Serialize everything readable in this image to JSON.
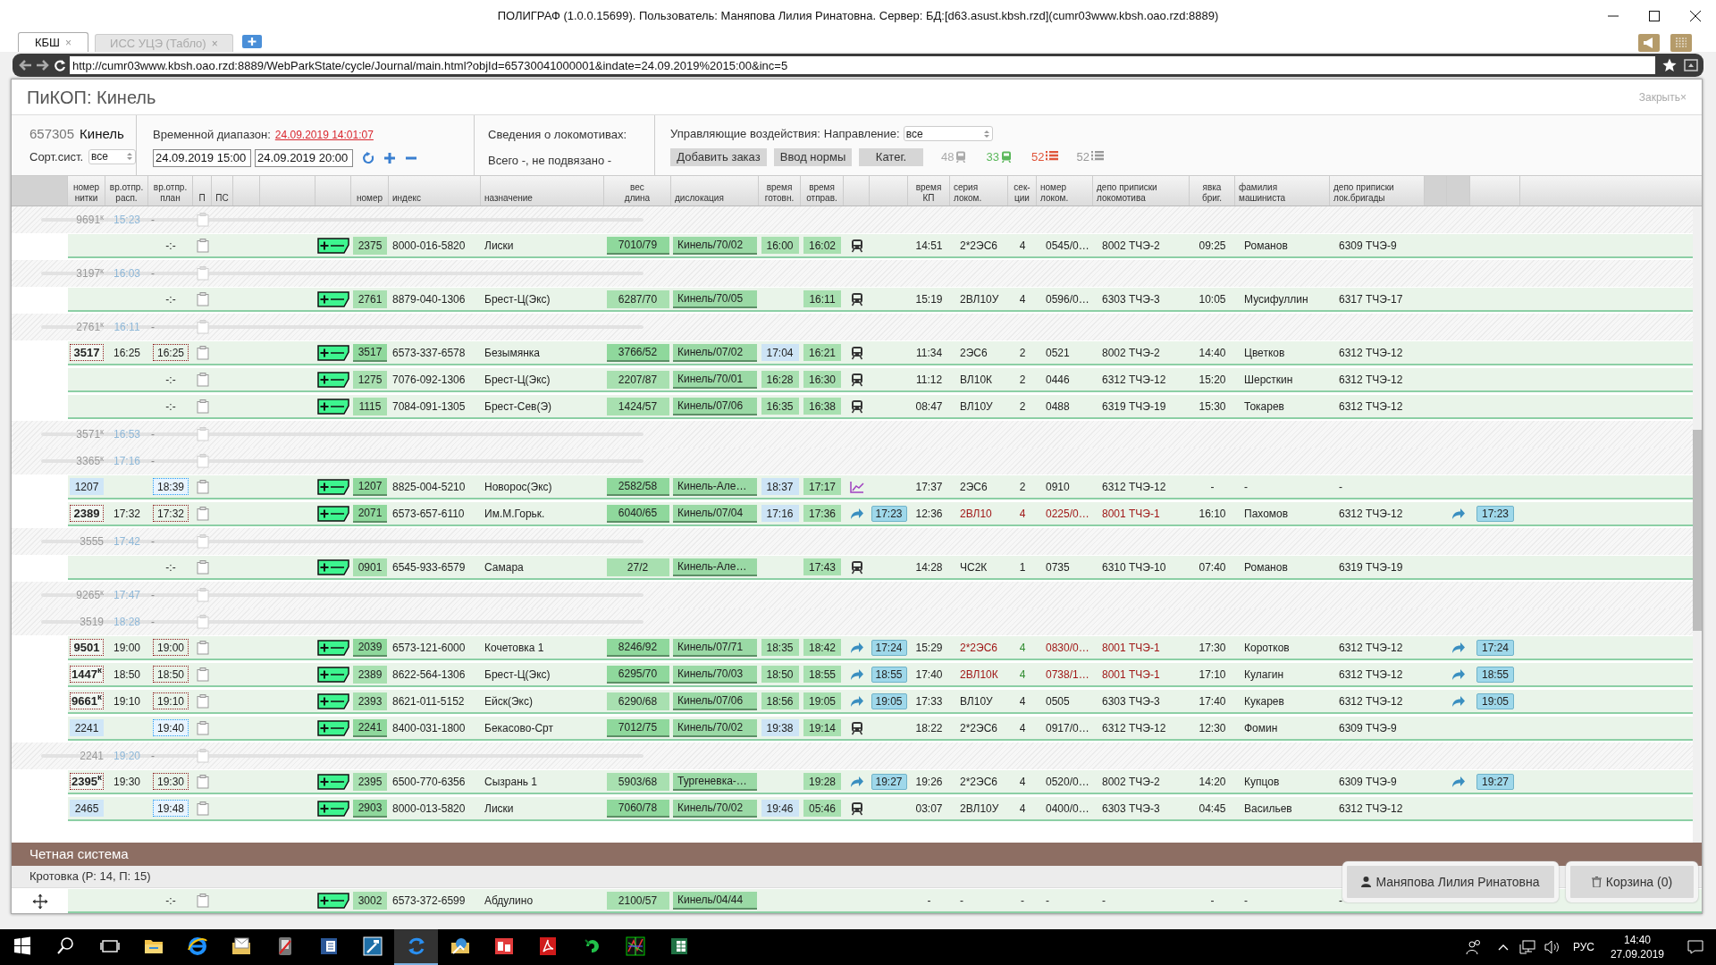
{
  "window": {
    "title": "ПОЛИГРАФ (1.0.0.15699). Пользователь: Маняпова Лилия Ринатовна. Сервер: БД:[d63.asust.kbsh.rzd](cumr03www.kbsh.oao.rzd:8889)"
  },
  "browser": {
    "tabs": [
      {
        "label": "КБШ",
        "close": "×",
        "selected": true
      },
      {
        "label": "ИСС УЦЭ (Табло)",
        "close": "×",
        "selected": false
      }
    ],
    "address": "http://cumr03www.kbsh.oao.rzd:8889/WebParkState/cycle/Journal/main.html?objId=65730041000001&indate=24.09.2019%2015:00&inc=5"
  },
  "app": {
    "title": "ПиКОП: Кинель",
    "close": "Закрыть×"
  },
  "station": {
    "code": "657305",
    "name": "Кинель",
    "sort_label": "Сорт.сист.",
    "sort_value": "все"
  },
  "time_range": {
    "label": "Временной диапазон:",
    "stamp": "24.09.2019 14:01:07",
    "from": "24.09.2019 15:00",
    "to": "24.09.2019 20:00"
  },
  "locos": {
    "label": "Сведения о локомотивах:",
    "summary": "Всего -, не подвязано -"
  },
  "controls": {
    "label": "Управляющие воздействия:",
    "direction_label": "Направление:",
    "direction": "все",
    "buttons": [
      "Добавить заказ",
      "Ввод нормы",
      "Катег."
    ],
    "counters": [
      {
        "value": "48",
        "kind": "train",
        "color": "#aaaaaa"
      },
      {
        "value": "33",
        "kind": "train",
        "color": "#5cb85c"
      },
      {
        "value": "52",
        "kind": "list",
        "color": "#e0553a"
      },
      {
        "value": "52",
        "kind": "list",
        "color": "#999999"
      }
    ]
  },
  "table": {
    "columns": [
      "номер\nнитки",
      "вр.отпр.\nрасп.",
      "вр.отпр.\nплан",
      "П",
      "ПС",
      "номер",
      "индекс",
      "назначение",
      "вес\nдлина",
      "дислокация",
      "время\nготовн.",
      "время\nотправ.",
      "время\nКП",
      "серия\nлоком.",
      "сек-\nции",
      "номер\nлоком.",
      "депо приписки\nлокомотива",
      "явка\nбриг.",
      "фамилия\nмашиниста",
      "депо приписки\nлок.бригады"
    ],
    "rows": [
      {
        "kind": "ghost",
        "thread": "9691$^{к}$",
        "time": "15:23",
        "dash": "-"
      },
      {
        "kind": "train",
        "plan": {
          "text": "-:-",
          "kind": "plain"
        },
        "number": "2375",
        "number_raised": false,
        "index": "8000-016-5820",
        "dest": "Лиски",
        "weight": "7010/79",
        "weight_raised": true,
        "location": "Кинель/70/02",
        "ready": {
          "text": "16:00",
          "kind": "green"
        },
        "depart": "16:02",
        "icon": {
          "kind": "loco"
        },
        "kp_time": "14:51",
        "series": "2*2ЭС6",
        "sections": {
          "text": "4",
          "kind": "plain"
        },
        "loco_no": "0545/0…",
        "loco_depot": "8002 ТЧЭ-2",
        "crew_time": "09:25",
        "driver": "Романов",
        "crew_depot": "6309 ТЧЭ-9",
        "alert": false
      },
      {
        "kind": "ghost",
        "thread": "3197$^{к}$",
        "time": "16:03",
        "dash": "-"
      },
      {
        "kind": "train",
        "plan": {
          "text": "-:-",
          "kind": "plain"
        },
        "number": "2761",
        "number_raised": false,
        "index": "8879-040-1306",
        "dest": "Брест-Ц(Экс)",
        "weight": "6287/70",
        "weight_raised": false,
        "location": "Кинель/70/05",
        "depart": "16:11",
        "icon": {
          "kind": "loco"
        },
        "kp_time": "15:19",
        "series": "2ВЛ10У",
        "sections": {
          "text": "4",
          "kind": "plain"
        },
        "loco_no": "0596/0…",
        "loco_depot": "6303 ТЧЭ-3",
        "crew_time": "10:05",
        "driver": "Мусифуллин",
        "crew_depot": "6317 ТЧЭ-17",
        "alert": false
      },
      {
        "kind": "ghost",
        "thread": "2761$^{к}$",
        "time": "16:11",
        "dash": "-"
      },
      {
        "kind": "train",
        "thread": {
          "text": "3517",
          "kind": "red"
        },
        "sched": "16:25",
        "plan": {
          "text": "16:25",
          "kind": "red"
        },
        "number": "3517",
        "number_raised": true,
        "index": "6573-337-6578",
        "dest": "Безымянка",
        "weight": "3766/52",
        "weight_raised": true,
        "location": "Кинель/07/02",
        "ready": {
          "text": "17:04",
          "kind": "blue"
        },
        "depart": "16:21",
        "icon": {
          "kind": "loco"
        },
        "kp_time": "11:34",
        "series": "2ЭС6",
        "sections": {
          "text": "2",
          "kind": "plain"
        },
        "loco_no": "0521",
        "loco_depot": "8002 ТЧЭ-2",
        "crew_time": "14:40",
        "driver": "Цветков",
        "crew_depot": "6312 ТЧЭ-12",
        "alert": false
      },
      {
        "kind": "train",
        "plan": {
          "text": "-:-",
          "kind": "plain"
        },
        "number": "1275",
        "number_raised": false,
        "index": "7076-092-1306",
        "dest": "Брест-Ц(Экс)",
        "weight": "2207/87",
        "weight_raised": false,
        "location": "Кинель/70/01",
        "ready": {
          "text": "16:28",
          "kind": "green"
        },
        "depart": "16:30",
        "icon": {
          "kind": "loco"
        },
        "kp_time": "11:12",
        "series": "ВЛ10К",
        "sections": {
          "text": "2",
          "kind": "plain"
        },
        "loco_no": "0446",
        "loco_depot": "6312 ТЧЭ-12",
        "crew_time": "15:20",
        "driver": "Шерсткин",
        "crew_depot": "6312 ТЧЭ-12",
        "alert": false
      },
      {
        "kind": "train",
        "plan": {
          "text": "-:-",
          "kind": "plain"
        },
        "number": "1115",
        "number_raised": false,
        "index": "7084-091-1305",
        "dest": "Брест-Сев(Э)",
        "weight": "1424/57",
        "weight_raised": false,
        "location": "Кинель/07/06",
        "ready": {
          "text": "16:35",
          "kind": "green"
        },
        "depart": "16:38",
        "icon": {
          "kind": "loco"
        },
        "kp_time": "08:47",
        "series": "ВЛ10У",
        "sections": {
          "text": "2",
          "kind": "plain"
        },
        "loco_no": "0488",
        "loco_depot": "6319 ТЧЭ-19",
        "crew_time": "15:30",
        "driver": "Токарев",
        "crew_depot": "6312 ТЧЭ-12",
        "alert": false
      },
      {
        "kind": "ghost",
        "thread": "3571$^{к}$",
        "time": "16:53",
        "dash": "-"
      },
      {
        "kind": "ghost",
        "thread": "3365$^{к}$",
        "time": "17:16",
        "dash": "-"
      },
      {
        "kind": "train",
        "thread": {
          "text": "1207",
          "kind": "blue"
        },
        "plan": {
          "text": "18:39",
          "kind": "blue"
        },
        "number": "1207",
        "number_raised": true,
        "index": "8825-004-5210",
        "dest": "Новорос(Экс)",
        "weight": "2582/58",
        "weight_raised": true,
        "location": "Кинель-Але…",
        "ready": {
          "text": "18:37",
          "kind": "blue"
        },
        "depart": "17:17",
        "icon": {
          "kind": "chart"
        },
        "kp_time": "17:37",
        "series": "2ЭС6",
        "sections": {
          "text": "2",
          "kind": "plain"
        },
        "loco_no": "0910",
        "loco_depot": "6312 ТЧЭ-12",
        "crew_time": "-",
        "driver": "-",
        "crew_depot": "-",
        "alert": false
      },
      {
        "kind": "train",
        "thread": {
          "text": "2389",
          "kind": "red"
        },
        "sched": "17:32",
        "plan": {
          "text": "17:32",
          "kind": "red"
        },
        "number": "2071",
        "number_raised": true,
        "index": "6573-657-6110",
        "dest": "Им.М.Горьк.",
        "weight": "6040/65",
        "weight_raised": true,
        "location": "Кинель/07/04",
        "ready": {
          "text": "17:16",
          "kind": "blue"
        },
        "depart": "17:36",
        "icon": {
          "kind": "arrow"
        },
        "kp_tag": "17:23",
        "kp_time": "12:36",
        "series": "2ВЛ10",
        "sections": {
          "text": "4",
          "kind": "red"
        },
        "loco_no": "0225/0…",
        "loco_depot": "8001 ТЧЭ-1",
        "crew_time": "16:10",
        "driver": "Пахомов",
        "crew_depot": "6312 ТЧЭ-12",
        "alert": true,
        "return_time": "17:23"
      },
      {
        "kind": "ghost",
        "thread": "3555",
        "time": "17:42",
        "dash": "-"
      },
      {
        "kind": "train",
        "plan": {
          "text": "-:-",
          "kind": "plain"
        },
        "number": "0901",
        "number_raised": false,
        "index": "6545-933-6579",
        "dest": "Самара",
        "weight": "27/2",
        "weight_raised": false,
        "location": "Кинель-Але…",
        "depart": "17:43",
        "icon": {
          "kind": "loco"
        },
        "kp_time": "14:28",
        "series": "ЧС2К",
        "sections": {
          "text": "1",
          "kind": "plain"
        },
        "loco_no": "0735",
        "loco_depot": "6310 ТЧЭ-10",
        "crew_time": "07:40",
        "driver": "Романов",
        "crew_depot": "6319 ТЧЭ-19",
        "alert": false
      },
      {
        "kind": "ghost",
        "thread": "9265$^{к}$",
        "time": "17:47",
        "dash": "-"
      },
      {
        "kind": "ghost",
        "thread": "3519",
        "time": "18:28",
        "dash": "-"
      },
      {
        "kind": "train",
        "thread": {
          "text": "9501",
          "kind": "red"
        },
        "sched": "19:00",
        "plan": {
          "text": "19:00",
          "kind": "red"
        },
        "number": "2039",
        "number_raised": true,
        "index": "6573-121-6000",
        "dest": "Кочетовка 1",
        "weight": "8246/92",
        "weight_raised": true,
        "location": "Кинель/07/71",
        "ready": {
          "text": "18:35",
          "kind": "green"
        },
        "depart": "18:42",
        "icon": {
          "kind": "arrow"
        },
        "kp_tag": "17:24",
        "kp_time": "15:29",
        "series": "2*2ЭС6",
        "sections": {
          "text": "4",
          "kind": "green"
        },
        "loco_no": "0830/0…",
        "loco_depot": "8001 ТЧЭ-1",
        "crew_time": "17:30",
        "driver": "Коротков",
        "crew_depot": "6312 ТЧЭ-12",
        "alert": true,
        "return_time": "17:24"
      },
      {
        "kind": "train",
        "thread": {
          "text": "1447$^{к}$",
          "kind": "red"
        },
        "sched": "18:50",
        "plan": {
          "text": "18:50",
          "kind": "red"
        },
        "number": "2389",
        "number_raised": false,
        "index": "8622-564-1306",
        "dest": "Брест-Ц(Экс)",
        "weight": "6295/70",
        "weight_raised": true,
        "location": "Кинель/70/03",
        "ready": {
          "text": "18:50",
          "kind": "green"
        },
        "depart": "18:55",
        "icon": {
          "kind": "arrow"
        },
        "kp_tag": "18:55",
        "kp_time": "17:40",
        "series": "2ВЛ10К",
        "sections": {
          "text": "4",
          "kind": "green"
        },
        "loco_no": "0738/1…",
        "loco_depot": "8001 ТЧЭ-1",
        "crew_time": "17:10",
        "driver": "Кулагин",
        "crew_depot": "6312 ТЧЭ-12",
        "alert": true,
        "return_time": "18:55"
      },
      {
        "kind": "train",
        "thread": {
          "text": "9661$^{к}$",
          "kind": "red"
        },
        "sched": "19:10",
        "plan": {
          "text": "19:10",
          "kind": "red"
        },
        "number": "2393",
        "number_raised": false,
        "index": "8621-011-5152",
        "dest": "Ейск(Экс)",
        "weight": "6290/68",
        "weight_raised": false,
        "location": "Кинель/07/06",
        "ready": {
          "text": "18:56",
          "kind": "green"
        },
        "depart": "19:05",
        "icon": {
          "kind": "arrow"
        },
        "kp_tag": "19:05",
        "kp_time": "17:33",
        "series": "ВЛ10У",
        "sections": {
          "text": "4",
          "kind": "plain"
        },
        "loco_no": "0505",
        "loco_depot": "6303 ТЧЭ-3",
        "crew_time": "17:40",
        "driver": "Кукарев",
        "crew_depot": "6312 ТЧЭ-12",
        "alert": false,
        "return_time": "19:05"
      },
      {
        "kind": "train",
        "thread": {
          "text": "2241",
          "kind": "blue"
        },
        "plan": {
          "text": "19:40",
          "kind": "blue"
        },
        "number": "2241",
        "number_raised": true,
        "index": "8400-031-1800",
        "dest": "Бекасово-Срт",
        "weight": "7012/75",
        "weight_raised": true,
        "location": "Кинель/70/02",
        "ready": {
          "text": "19:38",
          "kind": "blue"
        },
        "depart": "19:14",
        "icon": {
          "kind": "loco"
        },
        "kp_time": "18:22",
        "series": "2*2ЭС6",
        "sections": {
          "text": "4",
          "kind": "plain"
        },
        "loco_no": "0917/0…",
        "loco_depot": "6312 ТЧЭ-12",
        "crew_time": "12:30",
        "driver": "Фомин",
        "crew_depot": "6309 ТЧЭ-9",
        "alert": false
      },
      {
        "kind": "ghost",
        "thread": "2241",
        "time": "19:20",
        "dash": "-"
      },
      {
        "kind": "train",
        "thread": {
          "text": "2395$^{к}$",
          "kind": "red"
        },
        "sched": "19:30",
        "plan": {
          "text": "19:30",
          "kind": "red"
        },
        "number": "2395",
        "number_raised": false,
        "index": "6500-770-6356",
        "dest": "Сызрань 1",
        "weight": "5903/68",
        "weight_raised": false,
        "location": "Тургеневка-…",
        "depart": "19:28",
        "icon": {
          "kind": "arrow"
        },
        "kp_tag": "19:27",
        "kp_time": "19:26",
        "series": "2*2ЭС6",
        "sections": {
          "text": "4",
          "kind": "plain"
        },
        "loco_no": "0520/0…",
        "loco_depot": "8002 ТЧЭ-2",
        "crew_time": "14:20",
        "driver": "Купцов",
        "crew_depot": "6309 ТЧЭ-9",
        "alert": false,
        "return_time": "19:27"
      },
      {
        "kind": "train",
        "thread": {
          "text": "2465",
          "kind": "blue"
        },
        "plan": {
          "text": "19:48",
          "kind": "blue"
        },
        "number": "2903",
        "number_raised": true,
        "index": "8000-013-5820",
        "dest": "Лиски",
        "weight": "7060/78",
        "weight_raised": true,
        "location": "Кинель/70/02",
        "ready": {
          "text": "19:46",
          "kind": "blue"
        },
        "depart": "05:46",
        "icon": {
          "kind": "loco"
        },
        "kp_time": "03:07",
        "series": "2ВЛ10У",
        "sections": {
          "text": "4",
          "kind": "plain"
        },
        "loco_no": "0400/0…",
        "loco_depot": "6303 ТЧЭ-3",
        "crew_time": "04:45",
        "driver": "Васильев",
        "crew_depot": "6312 ТЧЭ-12",
        "alert": false
      }
    ]
  },
  "even_system": {
    "title": "Четная система",
    "group": "Кротовка (Р: 14, П: 15)",
    "row": {
      "kind": "train",
      "lead": {
        "kind": "move"
      },
      "plan": {
        "text": "-:-",
        "kind": "plain"
      },
      "number": "3002",
      "number_raised": false,
      "index": "6573-372-6599",
      "dest": "Абдулино",
      "weight": "2100/57",
      "weight_raised": false,
      "location": "Кинель/04/44",
      "kp_time": "-",
      "series": "-",
      "sections": {
        "text": "-",
        "kind": "plain"
      },
      "loco_no": "-",
      "loco_depot": "-",
      "crew_time": "-",
      "driver": "-",
      "crew_depot": "-",
      "alert": false
    }
  },
  "footer_buttons": [
    {
      "kind": "user",
      "label": "Маняпова Лилия Ринатовна"
    },
    {
      "kind": "cart",
      "label": "Корзина (0)"
    }
  ],
  "taskbar": {
    "apps": [
      {
        "kind": "start",
        "active": false
      },
      {
        "kind": "search",
        "active": false
      },
      {
        "kind": "taskview",
        "active": false
      },
      {
        "kind": "folder",
        "active": false
      },
      {
        "kind": "browser",
        "active": false
      },
      {
        "kind": "mail",
        "active": false
      },
      {
        "kind": "tool",
        "active": false
      },
      {
        "kind": "document",
        "active": false
      },
      {
        "kind": "hammer",
        "active": false
      },
      {
        "kind": "sync",
        "active": true
      },
      {
        "kind": "globe",
        "active": false
      },
      {
        "kind": "app",
        "active": false
      },
      {
        "kind": "pdf",
        "active": false
      },
      {
        "kind": "swirl",
        "active": false
      },
      {
        "kind": "chart",
        "active": false
      },
      {
        "kind": "sheet",
        "active": false
      }
    ],
    "language": "РУС",
    "time": "14:40",
    "date": "27.09.2019"
  }
}
